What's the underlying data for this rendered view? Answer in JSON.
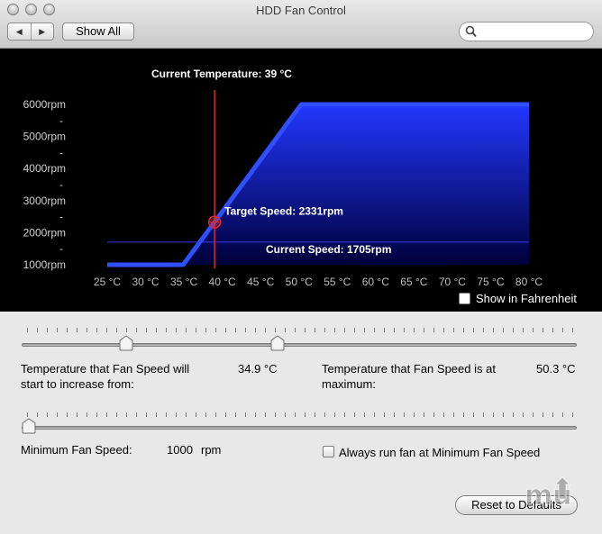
{
  "window": {
    "title": "HDD Fan Control",
    "show_all_label": "Show All",
    "back_glyph": "◀",
    "forward_glyph": "▶",
    "search_placeholder": ""
  },
  "chart_data": {
    "type": "area",
    "title": "",
    "current_temperature_label": "Current Temperature: 39 °C",
    "target_speed_label": "Target Speed: 2331rpm",
    "current_speed_label": "Current Speed: 1705rpm",
    "current_temperature_c": 39,
    "target_speed_rpm": 2331,
    "current_speed_rpm": 1705,
    "x_unit": "°C",
    "y_unit": "rpm",
    "xlim": [
      25,
      80
    ],
    "ylim": [
      1000,
      6000
    ],
    "x_ticks": [
      "25 °C",
      "30 °C",
      "35 °C",
      "40 °C",
      "45 °C",
      "50 °C",
      "55 °C",
      "60 °C",
      "65 °C",
      "70 °C",
      "75 °C",
      "80 °C"
    ],
    "x_tick_values": [
      25,
      30,
      35,
      40,
      45,
      50,
      55,
      60,
      65,
      70,
      75,
      80
    ],
    "y_ticks": [
      "1000rpm",
      "2000rpm",
      "3000rpm",
      "4000rpm",
      "5000rpm",
      "6000rpm"
    ],
    "y_tick_values": [
      1000,
      2000,
      3000,
      4000,
      5000,
      6000
    ],
    "y_minor_tick_glyph": "-",
    "series": [
      {
        "name": "",
        "x": [
          25,
          34.9,
          50.3,
          80
        ],
        "y": [
          1000,
          1000,
          6000,
          6000
        ]
      }
    ],
    "colors": {
      "area": "#1f3cff",
      "cursor": "#e02828",
      "background": "#000000"
    },
    "show_fahrenheit_label": "Show in Fahrenheit",
    "show_fahrenheit_checked": false
  },
  "controls": {
    "temp_start_label": "Temperature that Fan Speed will start to increase from:",
    "temp_start_value": "34.9 °C",
    "temp_max_label": "Temperature that Fan Speed is at maximum:",
    "temp_max_value": "50.3 °C",
    "temp_slider_min": 25,
    "temp_slider_max": 80,
    "temp_start": 34.9,
    "temp_max": 50.3,
    "min_speed_label": "Minimum Fan Speed:",
    "min_speed_value": "1000",
    "min_speed_unit": "rpm",
    "speed_slider_min": 1000,
    "speed_slider_max": 6000,
    "min_speed": 1000,
    "always_min_label": "Always run fan at Minimum Fan Speed",
    "always_min_checked": false,
    "reset_label": "Reset to Defaults",
    "logo_text": "mu"
  }
}
